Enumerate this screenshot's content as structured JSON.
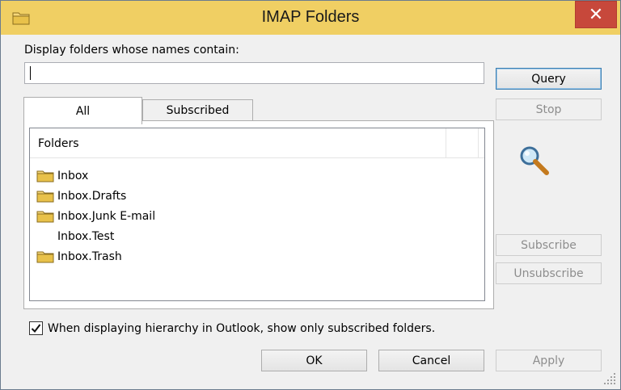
{
  "window": {
    "title": "IMAP Folders",
    "close_glyph": "✕"
  },
  "filter": {
    "label": "Display folders whose names contain:",
    "value": ""
  },
  "tabs": [
    {
      "label": "All",
      "selected": true
    },
    {
      "label": "Subscribed",
      "selected": false
    }
  ],
  "folders": {
    "column_header": "Folders",
    "items": [
      {
        "name": "Inbox",
        "icon": "folder-icon"
      },
      {
        "name": "Inbox.Drafts",
        "icon": "folder-icon"
      },
      {
        "name": "Inbox.Junk E-mail",
        "icon": "folder-icon"
      },
      {
        "name": "Inbox.Test",
        "icon": ""
      },
      {
        "name": "Inbox.Trash",
        "icon": "folder-icon"
      }
    ]
  },
  "side_buttons": {
    "query": "Query",
    "stop": "Stop",
    "subscribe": "Subscribe",
    "unsubscribe": "Unsubscribe"
  },
  "option": {
    "checked": true,
    "label": "When displaying hierarchy in Outlook, show only subscribed folders."
  },
  "footer_buttons": {
    "ok": "OK",
    "cancel": "Cancel",
    "apply": "Apply"
  },
  "colors": {
    "titlebar": "#f0cf63",
    "close_button": "#c7483b",
    "folder_icon": "#e8c14a"
  }
}
